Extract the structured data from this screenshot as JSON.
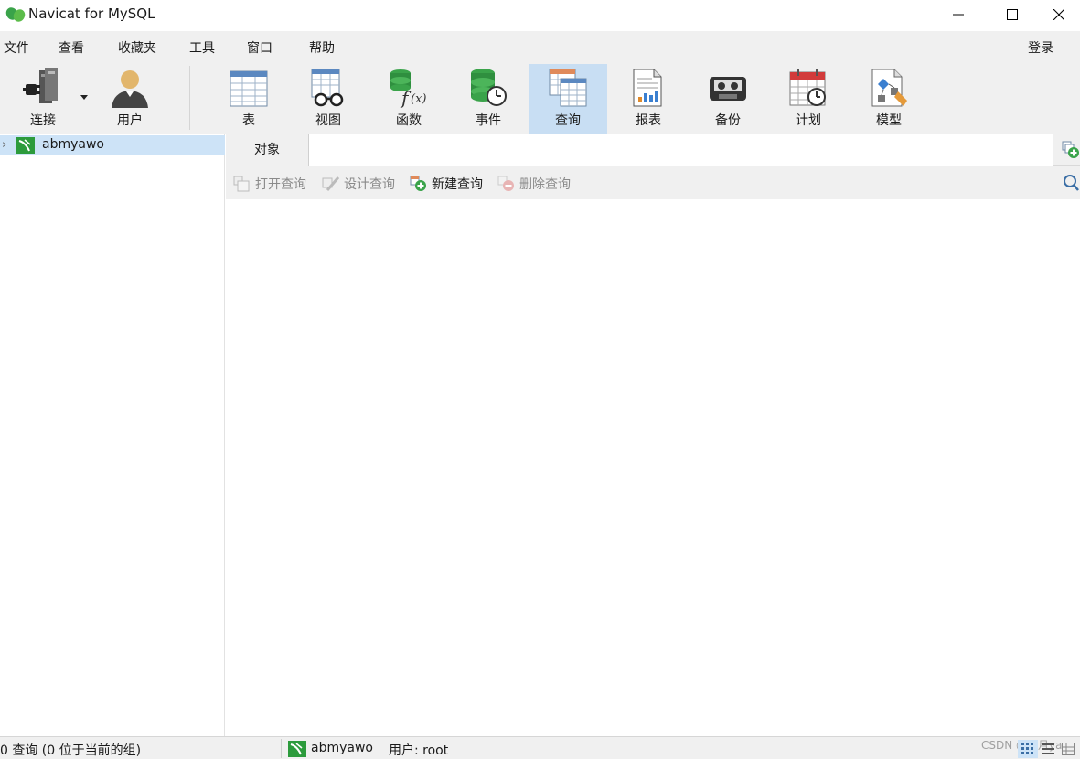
{
  "window": {
    "title": "Navicat for MySQL"
  },
  "menu": {
    "items": [
      "文件",
      "查看",
      "收藏夹",
      "工具",
      "窗口",
      "帮助"
    ],
    "login": "登录"
  },
  "toolbar": {
    "connect": "连接",
    "user": "用户",
    "table": "表",
    "view": "视图",
    "function": "函数",
    "event": "事件",
    "query": "查询",
    "report": "报表",
    "backup": "备份",
    "schedule": "计划",
    "model": "模型",
    "active": "query"
  },
  "sidebar": {
    "connection": "abmyawo"
  },
  "tabs": {
    "object": "对象"
  },
  "query_toolbar": {
    "open": "打开查询",
    "design": "设计查询",
    "new": "新建查询",
    "delete": "删除查询"
  },
  "status": {
    "count": "0 查询 (0 位于当前的组)",
    "connection": "abmyawo",
    "user": "用户: root",
    "watermark": "CSDN @君月ya"
  },
  "colors": {
    "accent": "#c8def3",
    "navicat_green": "#3aa34a",
    "selection": "#cde3f7"
  },
  "icons": {
    "connect": "plug-server-icon",
    "user": "user-icon",
    "table": "table-icon",
    "view": "view-glasses-icon",
    "function": "function-icon",
    "event": "event-clock-icon",
    "query": "query-icon",
    "report": "report-icon",
    "backup": "backup-tape-icon",
    "schedule": "calendar-icon",
    "model": "model-icon"
  }
}
